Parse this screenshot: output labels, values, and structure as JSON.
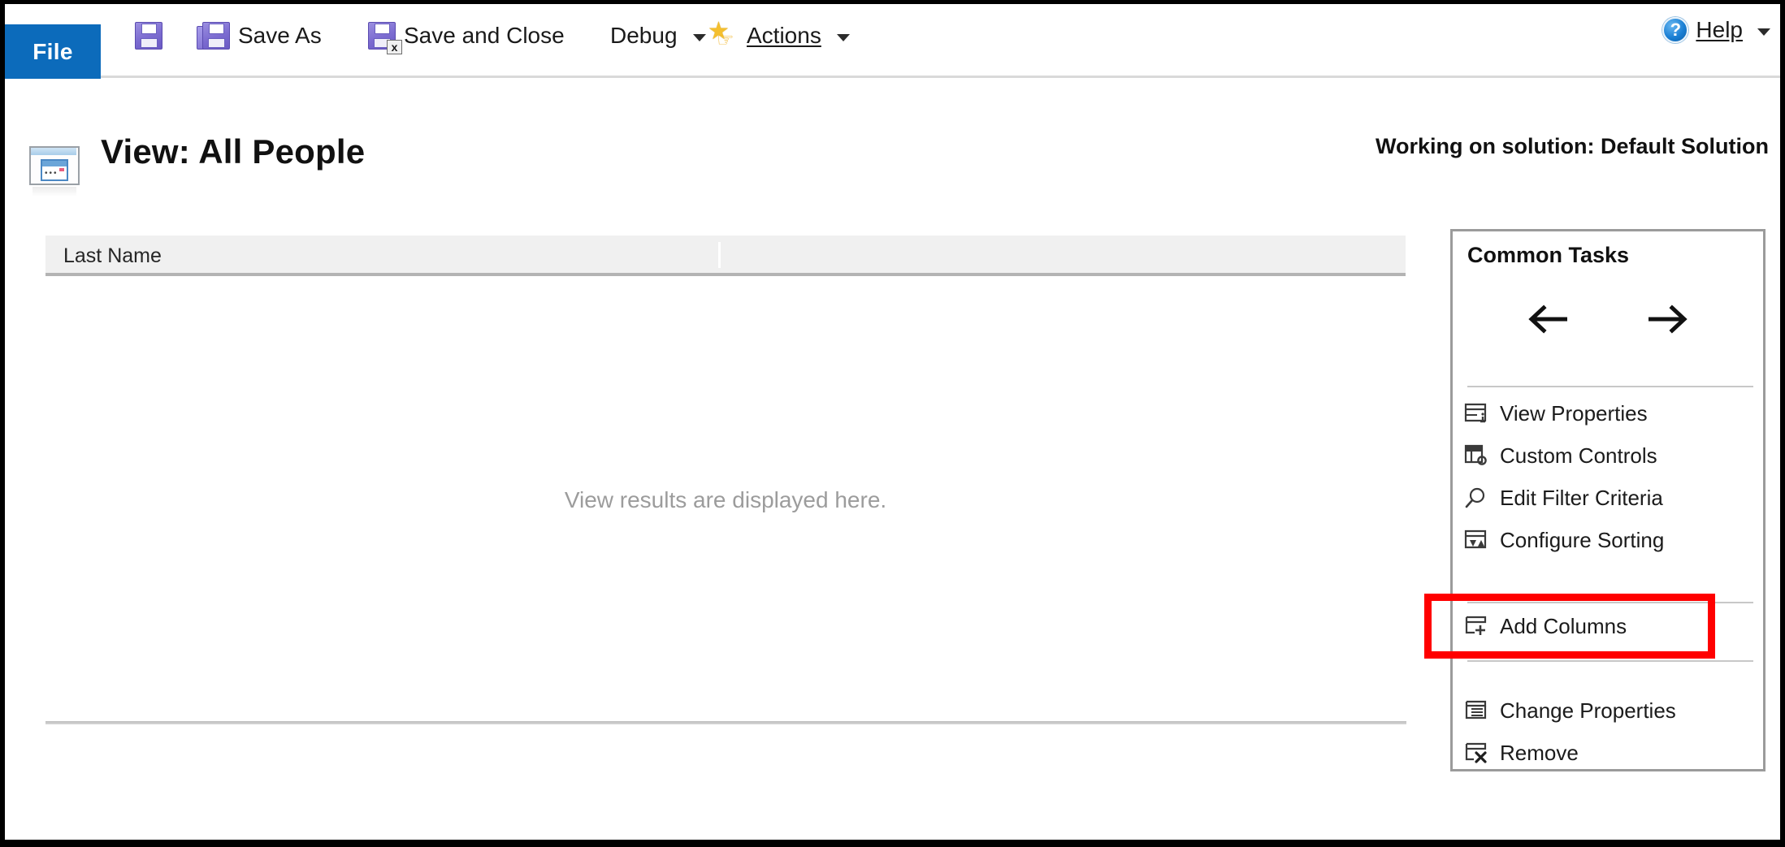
{
  "ribbon": {
    "file_tab": "File",
    "items": [
      {
        "id": "save",
        "label": "",
        "icon": "save-floppy-icon"
      },
      {
        "id": "save-as",
        "label": "Save As",
        "icon": "save-as-floppy-icon"
      },
      {
        "id": "save-and-close",
        "label": "Save and Close",
        "icon": "save-and-close-floppy-icon"
      },
      {
        "id": "debug",
        "label": "Debug",
        "icon": "chevron-down-icon"
      },
      {
        "id": "actions",
        "label": "Actions",
        "icon": "actions-star-hand-icon"
      }
    ],
    "help": {
      "label": "Help",
      "icon": "help-question-icon"
    }
  },
  "header": {
    "icon": "view-window-icon",
    "title": "View: All People",
    "solution_status": "Working on solution: Default Solution"
  },
  "grid": {
    "columns": [
      "Last Name",
      ""
    ],
    "empty_message": "View results are displayed here.",
    "rows": []
  },
  "common_tasks": {
    "title": "Common Tasks",
    "nav": {
      "back": "←",
      "forward": "→",
      "back_name": "move-left-arrow",
      "forward_name": "move-right-arrow"
    },
    "items": [
      {
        "id": "view-properties",
        "label": "View Properties",
        "icon": "view-properties-icon"
      },
      {
        "id": "custom-controls",
        "label": "Custom Controls",
        "icon": "custom-controls-icon"
      },
      {
        "id": "edit-filter-criteria",
        "label": "Edit Filter Criteria",
        "icon": "magnifier-icon"
      },
      {
        "id": "configure-sorting",
        "label": "Configure Sorting",
        "icon": "sort-icon"
      },
      {
        "id": "add-columns",
        "label": "Add Columns",
        "icon": "add-columns-icon"
      },
      {
        "id": "change-properties",
        "label": "Change Properties",
        "icon": "change-properties-icon"
      },
      {
        "id": "remove",
        "label": "Remove",
        "icon": "remove-columns-icon"
      }
    ]
  },
  "annotation": {
    "highlight_target": "Add Columns",
    "highlight_color": "#ff0000"
  },
  "colors": {
    "file_tab_blue": "#0c6bbb",
    "grid_header_gray": "#f0f0f0",
    "panel_border_gray": "#9b9b9b",
    "muted_text": "#9c9c9c",
    "highlight_red": "#ff0000"
  }
}
